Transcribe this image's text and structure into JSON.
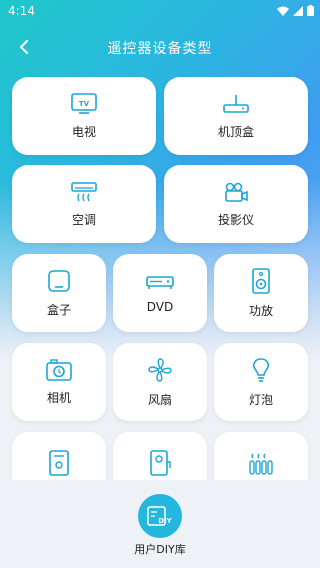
{
  "status_bar": {
    "time": "4:14"
  },
  "header": {
    "title": "遥控器设备类型"
  },
  "large_cards": [
    {
      "label": "电视",
      "icon": "tv-icon"
    },
    {
      "label": "机顶盒",
      "icon": "set-top-box-icon"
    },
    {
      "label": "空调",
      "icon": "air-conditioner-icon"
    },
    {
      "label": "投影仪",
      "icon": "projector-icon"
    }
  ],
  "small_cards": [
    {
      "label": "盒子",
      "icon": "box-icon"
    },
    {
      "label": "DVD",
      "icon": "dvd-icon"
    },
    {
      "label": "功放",
      "icon": "amplifier-icon"
    },
    {
      "label": "相机",
      "icon": "camera-icon"
    },
    {
      "label": "风扇",
      "icon": "fan-icon"
    },
    {
      "label": "灯泡",
      "icon": "bulb-icon"
    },
    {
      "label": "",
      "icon": "water-heater-icon"
    },
    {
      "label": "",
      "icon": "water-dispenser-icon"
    },
    {
      "label": "",
      "icon": "heater-icon"
    }
  ],
  "bottom": {
    "diy_label": "用户DIY库",
    "diy_badge": "DIY"
  },
  "colors": {
    "accent": "#25b6dd",
    "icon": "#1aa7d6"
  }
}
